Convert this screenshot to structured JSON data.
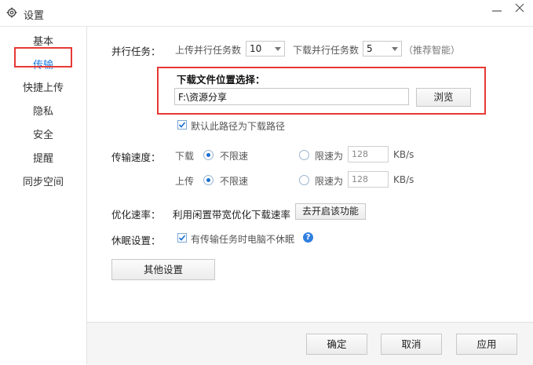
{
  "window": {
    "title": "设置"
  },
  "sidebar": {
    "items": [
      {
        "label": "基本"
      },
      {
        "label": "传输"
      },
      {
        "label": "快捷上传"
      },
      {
        "label": "隐私"
      },
      {
        "label": "安全"
      },
      {
        "label": "提醒"
      },
      {
        "label": "同步空间"
      }
    ],
    "active_index": 1
  },
  "parallel": {
    "label": "并行任务：",
    "upload_label": "上传并行任务数",
    "upload_value": "10",
    "download_label": "下载并行任务数",
    "download_value": "5",
    "hint": "（推荐智能）"
  },
  "download_path": {
    "label": "下载文件位置选择：",
    "value": "F:\\资源分享",
    "browse_label": "浏览",
    "default_checkbox_label": "默认此路径为下载路径",
    "default_checked": true
  },
  "speed": {
    "label": "传输速度：",
    "download_label": "下载",
    "upload_label": "上传",
    "unlimited_label": "不限速",
    "limit_label": "限速为",
    "download_limit": "128",
    "upload_limit": "128",
    "unit": "KB/s"
  },
  "optimize": {
    "label": "优化速率：",
    "text": "利用闲置带宽优化下载速率",
    "button_label": "去开启该功能"
  },
  "sleep": {
    "label": "休眠设置：",
    "checkbox_label": "有传输任务时电脑不休眠",
    "checked": true
  },
  "other_settings_label": "其他设置",
  "footer": {
    "ok_label": "确定",
    "cancel_label": "取消",
    "apply_label": "应用"
  },
  "colors": {
    "accent": "#1a7adf",
    "highlight_border": "#e53935"
  }
}
